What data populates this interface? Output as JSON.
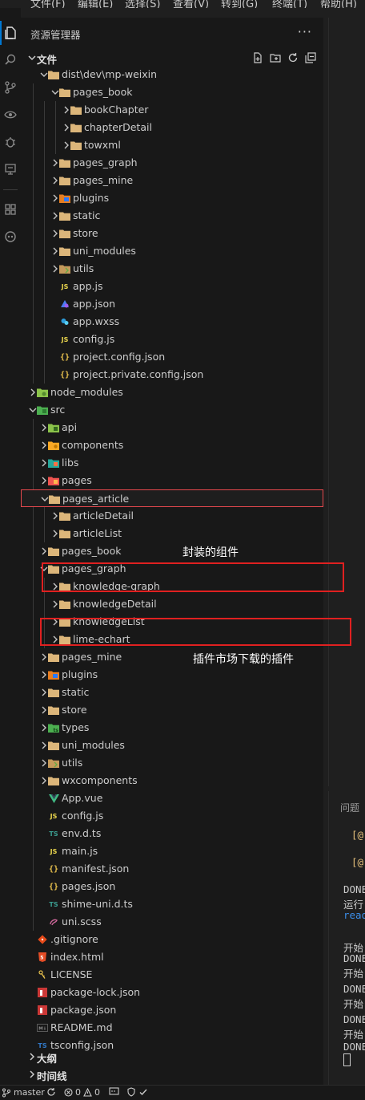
{
  "menubar": [
    "文件(F)",
    "编辑(E)",
    "选择(S)",
    "查看(V)",
    "转到(G)",
    "终端(T)",
    "帮助(H)"
  ],
  "sidebar": {
    "title": "资源管理器",
    "more": "···"
  },
  "explorer_section": {
    "label": "文件"
  },
  "outline_section": {
    "label": "大纲"
  },
  "timeline_section": {
    "label": "时间线"
  },
  "tree": [
    {
      "label": "dist\\dev\\mp-weixin",
      "depth": 1,
      "chevron": "down",
      "icon": "folder"
    },
    {
      "label": "pages_book",
      "depth": 2,
      "chevron": "down",
      "icon": "folder"
    },
    {
      "label": "bookChapter",
      "depth": 3,
      "chevron": "right",
      "icon": "folder"
    },
    {
      "label": "chapterDetail",
      "depth": 3,
      "chevron": "right",
      "icon": "folder"
    },
    {
      "label": "towxml",
      "depth": 3,
      "chevron": "right",
      "icon": "folder"
    },
    {
      "label": "pages_graph",
      "depth": 2,
      "chevron": "right",
      "icon": "folder"
    },
    {
      "label": "pages_mine",
      "depth": 2,
      "chevron": "right",
      "icon": "folder"
    },
    {
      "label": "plugins",
      "depth": 2,
      "chevron": "right",
      "icon": "folder-plugins"
    },
    {
      "label": "static",
      "depth": 2,
      "chevron": "right",
      "icon": "folder"
    },
    {
      "label": "store",
      "depth": 2,
      "chevron": "right",
      "icon": "folder"
    },
    {
      "label": "uni_modules",
      "depth": 2,
      "chevron": "right",
      "icon": "folder"
    },
    {
      "label": "utils",
      "depth": 2,
      "chevron": "right",
      "icon": "folder-utils"
    },
    {
      "label": "app.js",
      "depth": 2,
      "chevron": "none",
      "icon": "js"
    },
    {
      "label": "app.json",
      "depth": 2,
      "chevron": "none",
      "icon": "wx-json"
    },
    {
      "label": "app.wxss",
      "depth": 2,
      "chevron": "none",
      "icon": "wxss"
    },
    {
      "label": "config.js",
      "depth": 2,
      "chevron": "none",
      "icon": "js"
    },
    {
      "label": "project.config.json",
      "depth": 2,
      "chevron": "none",
      "icon": "json"
    },
    {
      "label": "project.private.config.json",
      "depth": 2,
      "chevron": "none",
      "icon": "json"
    },
    {
      "label": "node_modules",
      "depth": 0,
      "chevron": "right",
      "icon": "folder-node"
    },
    {
      "label": "src",
      "depth": 0,
      "chevron": "down",
      "icon": "folder-src"
    },
    {
      "label": "api",
      "depth": 1,
      "chevron": "right",
      "icon": "folder-api"
    },
    {
      "label": "components",
      "depth": 1,
      "chevron": "right",
      "icon": "folder-components"
    },
    {
      "label": "libs",
      "depth": 1,
      "chevron": "right",
      "icon": "folder-libs"
    },
    {
      "label": "pages",
      "depth": 1,
      "chevron": "right",
      "icon": "folder-pages"
    },
    {
      "label": "pages_article",
      "depth": 1,
      "chevron": "down",
      "icon": "folder",
      "selected": true
    },
    {
      "label": "articleDetail",
      "depth": 2,
      "chevron": "right",
      "icon": "folder"
    },
    {
      "label": "articleList",
      "depth": 2,
      "chevron": "right",
      "icon": "folder"
    },
    {
      "label": "pages_book",
      "depth": 1,
      "chevron": "right",
      "icon": "folder"
    },
    {
      "label": "pages_graph",
      "depth": 1,
      "chevron": "down",
      "icon": "folder"
    },
    {
      "label": "knowledge-graph",
      "depth": 2,
      "chevron": "right",
      "icon": "folder"
    },
    {
      "label": "knowledgeDetail",
      "depth": 2,
      "chevron": "right",
      "icon": "folder"
    },
    {
      "label": "knowledgeList",
      "depth": 2,
      "chevron": "right",
      "icon": "folder"
    },
    {
      "label": "lime-echart",
      "depth": 2,
      "chevron": "right",
      "icon": "folder"
    },
    {
      "label": "pages_mine",
      "depth": 1,
      "chevron": "right",
      "icon": "folder"
    },
    {
      "label": "plugins",
      "depth": 1,
      "chevron": "right",
      "icon": "folder-plugins"
    },
    {
      "label": "static",
      "depth": 1,
      "chevron": "right",
      "icon": "folder"
    },
    {
      "label": "store",
      "depth": 1,
      "chevron": "right",
      "icon": "folder"
    },
    {
      "label": "types",
      "depth": 1,
      "chevron": "right",
      "icon": "folder-types"
    },
    {
      "label": "uni_modules",
      "depth": 1,
      "chevron": "right",
      "icon": "folder"
    },
    {
      "label": "utils",
      "depth": 1,
      "chevron": "right",
      "icon": "folder-utils"
    },
    {
      "label": "wxcomponents",
      "depth": 1,
      "chevron": "right",
      "icon": "folder"
    },
    {
      "label": "App.vue",
      "depth": 1,
      "chevron": "none",
      "icon": "vue"
    },
    {
      "label": "config.js",
      "depth": 1,
      "chevron": "none",
      "icon": "js"
    },
    {
      "label": "env.d.ts",
      "depth": 1,
      "chevron": "none",
      "icon": "ts"
    },
    {
      "label": "main.js",
      "depth": 1,
      "chevron": "none",
      "icon": "js"
    },
    {
      "label": "manifest.json",
      "depth": 1,
      "chevron": "none",
      "icon": "json"
    },
    {
      "label": "pages.json",
      "depth": 1,
      "chevron": "none",
      "icon": "json"
    },
    {
      "label": "shime-uni.d.ts",
      "depth": 1,
      "chevron": "none",
      "icon": "ts"
    },
    {
      "label": "uni.scss",
      "depth": 1,
      "chevron": "none",
      "icon": "scss"
    },
    {
      "label": ".gitignore",
      "depth": 0,
      "chevron": "none",
      "icon": "git"
    },
    {
      "label": "index.html",
      "depth": 0,
      "chevron": "none",
      "icon": "html"
    },
    {
      "label": "LICENSE",
      "depth": 0,
      "chevron": "none",
      "icon": "license"
    },
    {
      "label": "package-lock.json",
      "depth": 0,
      "chevron": "none",
      "icon": "npm"
    },
    {
      "label": "package.json",
      "depth": 0,
      "chevron": "none",
      "icon": "npm"
    },
    {
      "label": "README.md",
      "depth": 0,
      "chevron": "none",
      "icon": "md"
    },
    {
      "label": "tsconfig.json",
      "depth": 0,
      "chevron": "none",
      "icon": "tsconfig"
    }
  ],
  "annotations": {
    "components_note": "封装的组件",
    "plugin_note": "插件市场下载的插件"
  },
  "panel": {
    "tab": "问题",
    "lines": [
      {
        "text": "[@",
        "color": "#e5c07b"
      },
      {
        "text": "[@",
        "color": "#e5c07b"
      },
      {
        "text": "DONE",
        "color": "#cccccc"
      },
      {
        "text": "运行",
        "color": "#cccccc"
      },
      {
        "text": "read",
        "color": "#3b8eea"
      },
      {
        "text": "开始",
        "color": "#cccccc"
      },
      {
        "text": "DONE",
        "color": "#cccccc"
      },
      {
        "text": "开始",
        "color": "#cccccc"
      },
      {
        "text": "DONE",
        "color": "#cccccc"
      },
      {
        "text": "开始",
        "color": "#cccccc"
      },
      {
        "text": "DONE",
        "color": "#cccccc"
      },
      {
        "text": "开始",
        "color": "#cccccc"
      },
      {
        "text": "DONE",
        "color": "#cccccc"
      }
    ]
  },
  "statusbar": {
    "branch": "master",
    "errors": "0",
    "warnings": "0"
  },
  "colors": {
    "folder": "#dcb67a",
    "accent": "#0078d4",
    "selection_border": "#e5484d",
    "annotation": "#e02020"
  }
}
